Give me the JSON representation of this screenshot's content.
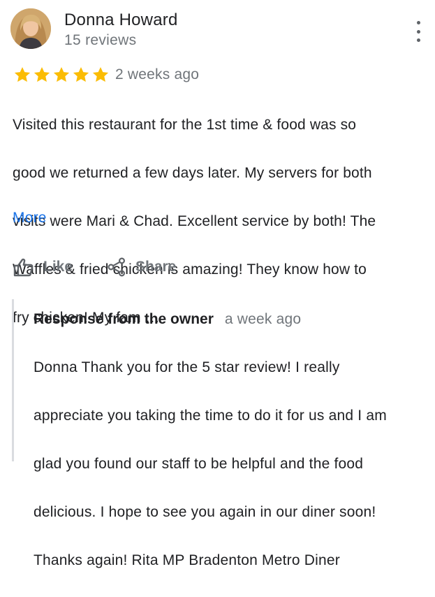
{
  "reviewer": {
    "name": "Donna Howard",
    "meta": "15 reviews"
  },
  "review": {
    "rating": 5,
    "date": "2 weeks ago",
    "text_lines": [
      "Visited this restaurant for the 1st time & food was so",
      "good we returned a few days later.  My servers for both",
      "visits were Mari & Chad. Excellent service by both! The",
      "Waffles & fried chicken is amazing! They know how to",
      "fry chicken! My fam …"
    ],
    "more_label": "More"
  },
  "actions": {
    "like_label": "Like",
    "share_label": "Share"
  },
  "owner_response": {
    "title": "Response from the owner",
    "date": "a week ago",
    "text_lines": [
      "Donna   Thank you for the 5 star review!  I really",
      "appreciate you taking the time to do it for us and I am",
      "glad you found our staff to be helpful and the food",
      "delicious.  I hope to see you again in our diner soon!",
      "Thanks again!  Rita  MP  Bradenton Metro Diner"
    ]
  },
  "colors": {
    "star": "#fbbc04",
    "link": "#1a73e8",
    "secondary_text": "#70757a",
    "primary_text": "#202124"
  },
  "icons": {
    "avatar": "profile-photo",
    "menu": "more-vert-icon",
    "star": "star-icon",
    "like": "thumb-up-icon",
    "share": "share-icon"
  }
}
